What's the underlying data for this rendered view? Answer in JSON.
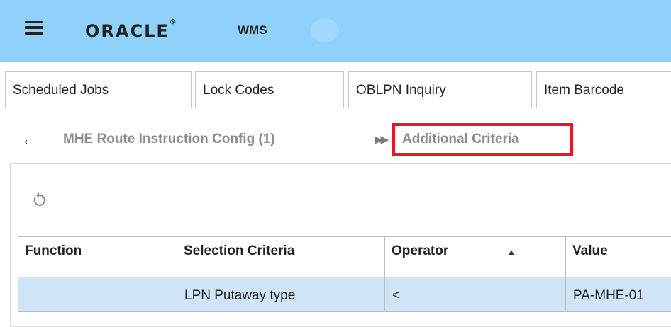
{
  "header": {
    "logo_text": "ORACLE",
    "logo_mark": "®",
    "app_name": "WMS",
    "background_color": "#8fd1fb"
  },
  "tabs": [
    {
      "label": "Scheduled Jobs"
    },
    {
      "label": "Lock Codes"
    },
    {
      "label": "OBLPN Inquiry"
    },
    {
      "label": "Item Barcode"
    }
  ],
  "breadcrumb": {
    "back_icon": "arrow-left-icon",
    "parent": "MHE Route Instruction Config (1)",
    "separator": "▶▶",
    "current": "Additional Criteria",
    "highlight_color": "#e01b24"
  },
  "toolbar": {
    "refresh_icon": "refresh-icon"
  },
  "table": {
    "columns": [
      "Function",
      "Selection Criteria",
      "Operator",
      "Value"
    ],
    "sort_indicator": "▲",
    "rows": [
      [
        "",
        "LPN Putaway type",
        "<",
        "PA-MHE-01"
      ]
    ],
    "selected_row_color": "#cfe4f7"
  }
}
